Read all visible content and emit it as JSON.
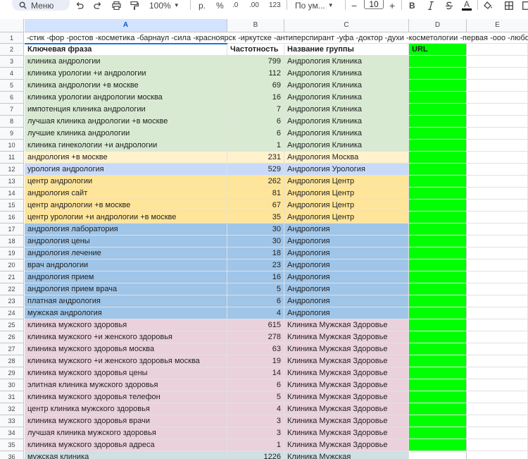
{
  "toolbar": {
    "menu_label": "Меню",
    "zoom": "100%",
    "currency": "р.",
    "percent": "%",
    "dec_decrease": ".0",
    "dec_increase": ".00",
    "number_format": "123",
    "font_name": "По ум...",
    "font_size": "10",
    "bold": "B",
    "text_color": "A"
  },
  "columns": [
    "A",
    "B",
    "C",
    "D",
    "E"
  ],
  "selected_column": "A",
  "row1_text": "-стик -фор -ростов -косметика -барнаул -сила -красноярск -иркутске -антиперспирант -уфа -доктор -духи -косметологии  -первая -ооо -любовь -",
  "headers": {
    "phrase": "Ключевая фраза",
    "freq": "Частотность",
    "group": "Название группы",
    "url": "URL"
  },
  "colors": {
    "green": "#d9ead3",
    "yellow": "#fff2cc",
    "blue_light": "#c9daf8",
    "orange": "#ffe599",
    "blue": "#9fc5e8",
    "pink": "#ead1dc",
    "teal": "#d0e0e3",
    "url_fill": "#00ff00"
  },
  "rows": [
    {
      "n": "3",
      "phrase": "клиника андрологии",
      "freq": "799",
      "group": "Андрология Клиника",
      "color": "green"
    },
    {
      "n": "4",
      "phrase": "клиника урологии +и андрологии",
      "freq": "112",
      "group": "Андрология Клиника",
      "color": "green"
    },
    {
      "n": "5",
      "phrase": "клиника андрологии +в москве",
      "freq": "69",
      "group": "Андрология Клиника",
      "color": "green"
    },
    {
      "n": "6",
      "phrase": "клиника урологии андрологии москва",
      "freq": "16",
      "group": "Андрология Клиника",
      "color": "green"
    },
    {
      "n": "7",
      "phrase": "импотенция клиника андрологии",
      "freq": "7",
      "group": "Андрология Клиника",
      "color": "green"
    },
    {
      "n": "8",
      "phrase": "лучшая клиника андрологии +в москве",
      "freq": "6",
      "group": "Андрология Клиника",
      "color": "green"
    },
    {
      "n": "9",
      "phrase": "лучшие клиника андрологии",
      "freq": "6",
      "group": "Андрология Клиника",
      "color": "green"
    },
    {
      "n": "10",
      "phrase": "клиника гинекологии +и андрологии",
      "freq": "1",
      "group": "Андрология Клиника",
      "color": "green"
    },
    {
      "n": "11",
      "phrase": "андрология +в москве",
      "freq": "231",
      "group": "Андрология Москва",
      "color": "yellow"
    },
    {
      "n": "12",
      "phrase": "урология андрология",
      "freq": "529",
      "group": "Андрология Урология",
      "color": "blue_light"
    },
    {
      "n": "13",
      "phrase": "центр андрологии",
      "freq": "262",
      "group": "Андрология Центр",
      "color": "orange"
    },
    {
      "n": "14",
      "phrase": "андрология сайт",
      "freq": "81",
      "group": "Андрология Центр",
      "color": "orange"
    },
    {
      "n": "15",
      "phrase": "центр андрологии +в москве",
      "freq": "67",
      "group": "Андрология Центр",
      "color": "orange"
    },
    {
      "n": "16",
      "phrase": "центр урологии +и андрологии +в москве",
      "freq": "35",
      "group": "Андрология Центр",
      "color": "orange"
    },
    {
      "n": "17",
      "phrase": "андрология лаборатория",
      "freq": "30",
      "group": "Андрология",
      "color": "blue"
    },
    {
      "n": "18",
      "phrase": "андрология цены",
      "freq": "30",
      "group": "Андрология",
      "color": "blue"
    },
    {
      "n": "19",
      "phrase": "андрология лечение",
      "freq": "18",
      "group": "Андрология",
      "color": "blue"
    },
    {
      "n": "20",
      "phrase": "врач андрологии",
      "freq": "23",
      "group": "Андрология",
      "color": "blue"
    },
    {
      "n": "21",
      "phrase": "андрология прием",
      "freq": "16",
      "group": "Андрология",
      "color": "blue"
    },
    {
      "n": "22",
      "phrase": "андрология прием врача",
      "freq": "5",
      "group": "Андрология",
      "color": "blue"
    },
    {
      "n": "23",
      "phrase": "платная андрология",
      "freq": "6",
      "group": "Андрология",
      "color": "blue"
    },
    {
      "n": "24",
      "phrase": "мужская андрология",
      "freq": "4",
      "group": "Андрология",
      "color": "blue"
    },
    {
      "n": "25",
      "phrase": "клиника мужского здоровья",
      "freq": "615",
      "group": "Клиника Мужская Здоровье",
      "color": "pink"
    },
    {
      "n": "26",
      "phrase": "клиника мужского +и женского здоровья",
      "freq": "278",
      "group": "Клиника Мужская Здоровье",
      "color": "pink"
    },
    {
      "n": "27",
      "phrase": "клиника мужского здоровья москва",
      "freq": "63",
      "group": "Клиника Мужская Здоровье",
      "color": "pink"
    },
    {
      "n": "28",
      "phrase": "клиника мужского +и женского здоровья москва",
      "freq": "19",
      "group": "Клиника Мужская Здоровье",
      "color": "pink"
    },
    {
      "n": "29",
      "phrase": "клиника мужского здоровья цены",
      "freq": "14",
      "group": "Клиника Мужская Здоровье",
      "color": "pink"
    },
    {
      "n": "30",
      "phrase": "элитная клиника мужского здоровья",
      "freq": "6",
      "group": "Клиника Мужская Здоровье",
      "color": "pink"
    },
    {
      "n": "31",
      "phrase": "клиника мужского здоровья телефон",
      "freq": "5",
      "group": "Клиника Мужская Здоровье",
      "color": "pink"
    },
    {
      "n": "32",
      "phrase": "центр клиника мужского здоровья",
      "freq": "4",
      "group": "Клиника Мужская Здоровье",
      "color": "pink"
    },
    {
      "n": "33",
      "phrase": "клиника мужского здоровья врачи",
      "freq": "3",
      "group": "Клиника Мужская Здоровье",
      "color": "pink"
    },
    {
      "n": "34",
      "phrase": "лучшая клиника мужского здоровья",
      "freq": "3",
      "group": "Клиника Мужская Здоровье",
      "color": "pink"
    },
    {
      "n": "35",
      "phrase": "клиника мужского здоровья адреса",
      "freq": "1",
      "group": "Клиника Мужская Здоровье",
      "color": "pink"
    },
    {
      "n": "36",
      "phrase": "мужская клиника",
      "freq": "1226",
      "group": "Клиника Мужская",
      "color": "teal"
    }
  ]
}
